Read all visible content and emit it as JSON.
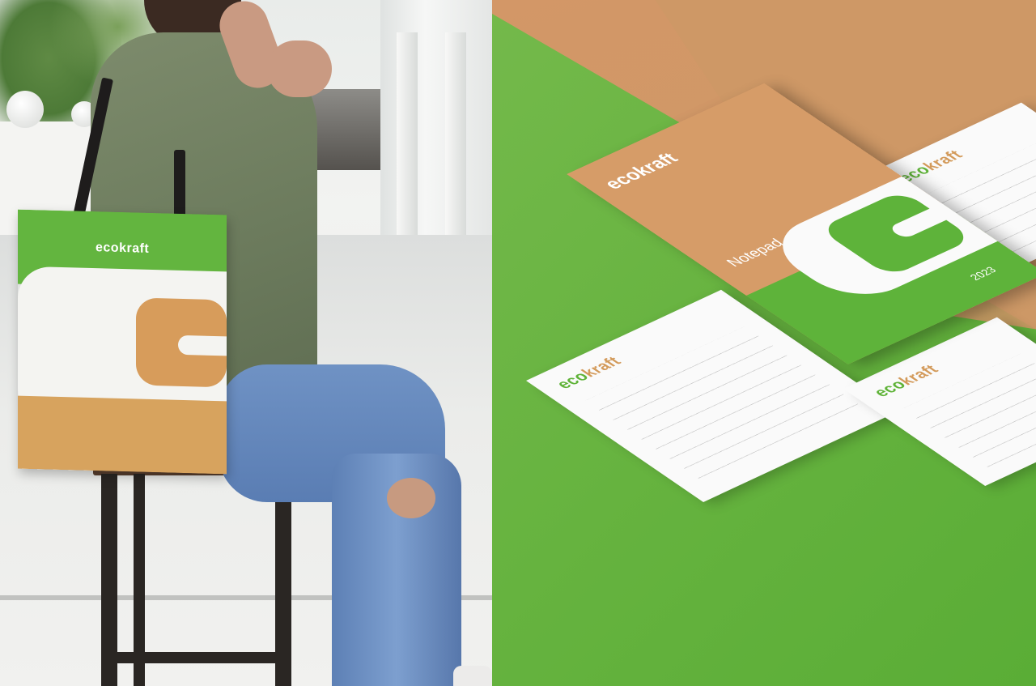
{
  "tote_bag": {
    "logo_text": "ecokraft"
  },
  "notepad_cover": {
    "logo_text": "ecokraft",
    "title": "Notepad",
    "year": "2023"
  },
  "pads": [
    {
      "logo_eco": "eco",
      "logo_kraft": "kraft"
    },
    {
      "logo_eco": "eco",
      "logo_kraft": "kraft"
    },
    {
      "logo_eco": "eco",
      "logo_kraft": "kraft"
    }
  ],
  "colors": {
    "brand_green": "#5fb338",
    "brand_tan": "#d39a5a",
    "paper": "#fafafa"
  }
}
